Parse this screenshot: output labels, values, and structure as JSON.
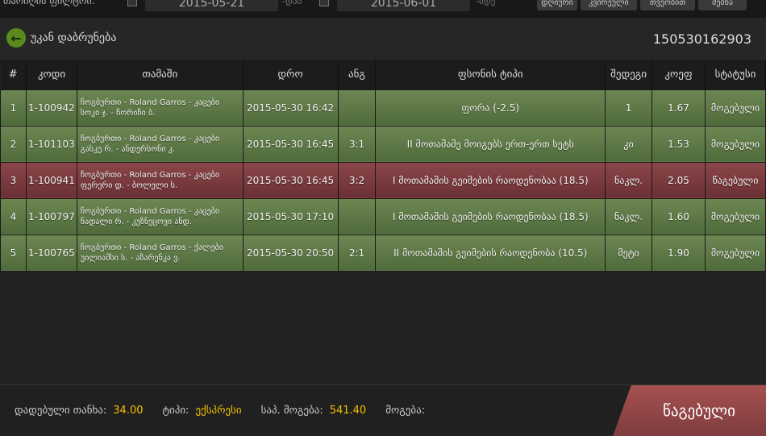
{
  "filter": {
    "label": "თარიღის ფილტრი:",
    "from": "2015-05-21",
    "from_suffix": "-დან",
    "to": "2015-06-01",
    "to_suffix": "-მდე",
    "buttons": [
      "დღიური",
      "კვირეული",
      "თვეობით",
      "ძებნა"
    ]
  },
  "nav": {
    "back_label": "უკან დაბრუნება",
    "ticket_id": "150530162903"
  },
  "table": {
    "headers": [
      "#",
      "კოდი",
      "თამაში",
      "დრო",
      "ანგ",
      "ფსონის ტიპი",
      "შედეგი",
      "კოეფ",
      "სტატუსი"
    ],
    "rows": [
      {
        "n": "1",
        "code": "1-100942",
        "game1": "ჩოგბურთი - Roland Garros - კაცები",
        "game2": "სოკი ჯ. - ჩორიჩი ბ.",
        "time": "2015-05-30 16:42",
        "score": "",
        "type": "ფორა (-2.5)",
        "result": "1",
        "odds": "1.67",
        "status": "მოგებული",
        "state": "won"
      },
      {
        "n": "2",
        "code": "1-101103",
        "game1": "ჩოგბურთი - Roland Garros - კაცები",
        "game2": "გასკე რ. - ანდერსონი კ.",
        "time": "2015-05-30 16:45",
        "score": "3:1",
        "type": "II მოთამაშე მოიგებს ერთ-ერთ სეტს",
        "result": "კი",
        "odds": "1.53",
        "status": "მოგებული",
        "state": "won"
      },
      {
        "n": "3",
        "code": "1-100941",
        "game1": "ჩოგბურთი - Roland Garros - კაცები",
        "game2": "ფერერი დ. - ბოლელი ს.",
        "time": "2015-05-30 16:45",
        "score": "3:2",
        "type": "I მოთამაშის გეიმების რაოდენობაა (18.5)",
        "result": "ნაკლ.",
        "odds": "2.05",
        "status": "წაგებული",
        "state": "lost"
      },
      {
        "n": "4",
        "code": "1-100797",
        "game1": "ჩოგბურთი - Roland Garros - კაცები",
        "game2": "ნადალი რ. - კუზნეცოვი ანდ.",
        "time": "2015-05-30 17:10",
        "score": "",
        "type": "I მოთამაშის გეიმების რაოდენობაა (18.5)",
        "result": "ნაკლ.",
        "odds": "1.60",
        "status": "მოგებული",
        "state": "won"
      },
      {
        "n": "5",
        "code": "1-100765",
        "game1": "ჩოგბურთი - Roland Garros - ქალები",
        "game2": "უილიამსი ს. - აზარენკა ვ.",
        "time": "2015-05-30 20:50",
        "score": "2:1",
        "type": "II მოთამაშის გეიმების რაოდენობა (10.5)",
        "result": "მეტი",
        "odds": "1.90",
        "status": "მოგებული",
        "state": "won"
      }
    ]
  },
  "footer": {
    "stake_label": "დადებული თანხა:",
    "stake": "34.00",
    "type_label": "ტიპი:",
    "type": "ექსპრესი",
    "potential_label": "საპ. მოგება:",
    "potential": "541.40",
    "win_label": "მოგება:",
    "status": "წაგებული"
  }
}
